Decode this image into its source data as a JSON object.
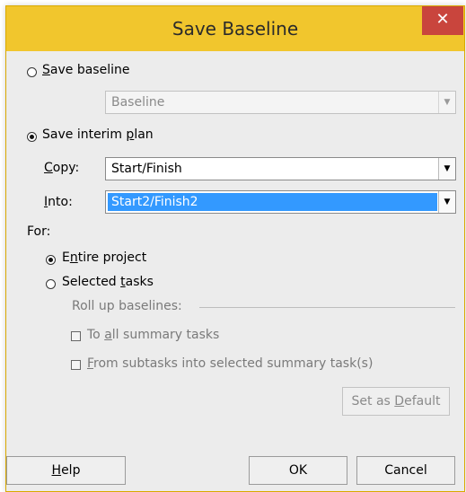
{
  "dialog": {
    "title": "Save Baseline",
    "close_glyph": "✕"
  },
  "save_baseline": {
    "label_prefix": "",
    "label_accel": "S",
    "label_rest": "ave baseline",
    "selected": false,
    "dropdown_value": "Baseline",
    "dropdown_enabled": false
  },
  "save_interim": {
    "label_prefix": "Save interim ",
    "label_accel": "p",
    "label_rest": "lan",
    "selected": true,
    "copy": {
      "label_accel": "C",
      "label_rest": "opy:",
      "value": "Start/Finish"
    },
    "into": {
      "label_accel": "I",
      "label_rest": "nto:",
      "value": "Start2/Finish2"
    }
  },
  "for_section": {
    "label": "For:",
    "entire_project": {
      "label_prefix": "E",
      "label_accel": "n",
      "label_rest": "tire project",
      "selected": true
    },
    "selected_tasks": {
      "label_prefix": "Selected ",
      "label_accel": "t",
      "label_rest": "asks",
      "selected": false
    },
    "rollup": {
      "label": "Roll up baselines:",
      "to_all_summary": {
        "label_prefix": "To ",
        "label_accel": "a",
        "label_rest": "ll summary tasks",
        "checked": false
      },
      "from_subtasks": {
        "label_prefix": "",
        "label_accel": "F",
        "label_rest": "rom subtasks into selected summary task(s)",
        "checked": false
      }
    }
  },
  "buttons": {
    "set_default": {
      "prefix": "Set as ",
      "accel": "D",
      "rest": "efault"
    },
    "help": {
      "prefix": "",
      "accel": "H",
      "rest": "elp"
    },
    "ok": "OK",
    "cancel": "Cancel"
  },
  "icons": {
    "dropdown_arrow": "▼"
  }
}
